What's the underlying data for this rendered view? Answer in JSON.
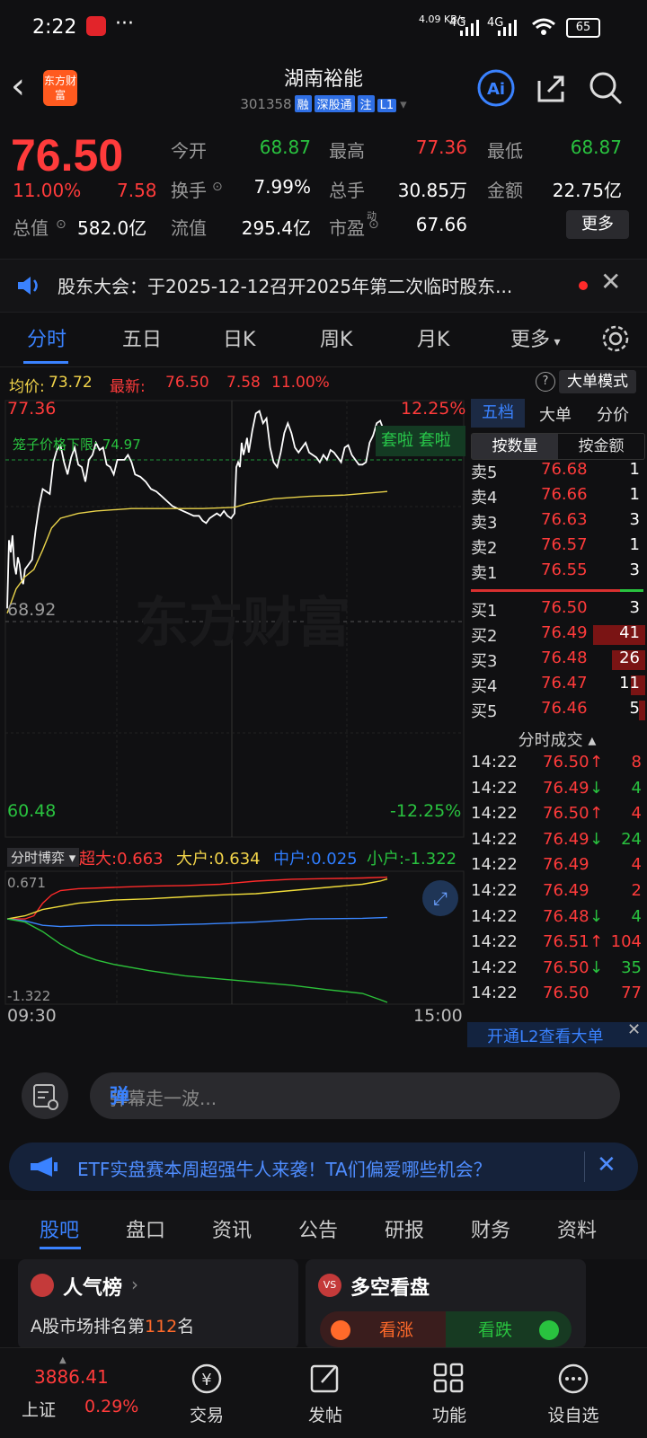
{
  "status_bar": {
    "time": "2:22",
    "net_speed": "4.09 KB/s",
    "signal1": "4G",
    "signal2": "4G",
    "battery": "65"
  },
  "header": {
    "brand": "东方财富",
    "title": "湖南裕能",
    "code": "301358",
    "tags": [
      "融",
      "深股通",
      "注",
      "L1"
    ]
  },
  "quote": {
    "price": "76.50",
    "change_pct": "11.00%",
    "change": "7.58",
    "open_label": "今开",
    "open": "68.87",
    "high_label": "最高",
    "high": "77.36",
    "low_label": "最低",
    "low": "68.87",
    "turnover_label": "换手",
    "turnover": "7.99%",
    "volume_label": "总手",
    "volume": "30.85万",
    "amount_label": "金额",
    "amount": "22.75亿",
    "mktcap_label": "总值",
    "mktcap": "582.0亿",
    "float_label": "流值",
    "float": "295.4亿",
    "pe_label": "市盈",
    "pe_sup": "动",
    "pe": "67.66",
    "more": "更多"
  },
  "announcement": {
    "text": "股东大会：于2025-12-12召开2025年第二次临时股东..."
  },
  "period_tabs": [
    "分时",
    "五日",
    "日K",
    "周K",
    "月K",
    "更多"
  ],
  "chart_header": {
    "avg_label": "均价:",
    "avg": "73.72",
    "latest_label": "最新:",
    "latest": "76.50",
    "latest_chg": "7.58",
    "latest_pct": "11.00%",
    "mode_button": "大单模式"
  },
  "chart_labels": {
    "top_price": "77.36",
    "top_pct": "12.25%",
    "limit_label": "笼子价格下限: 74.97",
    "mid_price": "68.92",
    "bottom_price": "60.48",
    "bottom_pct": "-12.25%",
    "watermark": "东方财富",
    "flag1": "套啦",
    "flag2": "套啦"
  },
  "sub_chart": {
    "selector": "分时博弈",
    "super_large_label": "超大:",
    "super_large": "0.663",
    "large_label": "大户:",
    "large": "0.634",
    "medium_label": "中户:",
    "medium": "0.025",
    "small_label": "小户:",
    "small": "-1.322",
    "max_label": "0.671",
    "min_label": "-1.322",
    "start_time": "09:30",
    "end_time": "15:00"
  },
  "order_book": {
    "tabs": [
      "五档",
      "大单",
      "分价"
    ],
    "mode_tabs": [
      "按数量",
      "按金额"
    ],
    "asks": [
      {
        "label": "卖5",
        "price": "76.68",
        "qty": "1"
      },
      {
        "label": "卖4",
        "price": "76.66",
        "qty": "1"
      },
      {
        "label": "卖3",
        "price": "76.63",
        "qty": "3"
      },
      {
        "label": "卖2",
        "price": "76.57",
        "qty": "1"
      },
      {
        "label": "卖1",
        "price": "76.55",
        "qty": "3"
      }
    ],
    "bids": [
      {
        "label": "买1",
        "price": "76.50",
        "qty": "3",
        "bar": 0.0
      },
      {
        "label": "买2",
        "price": "76.49",
        "qty": "41",
        "bar": 1.0
      },
      {
        "label": "买3",
        "price": "76.48",
        "qty": "26",
        "bar": 0.63
      },
      {
        "label": "买4",
        "price": "76.47",
        "qty": "11",
        "bar": 0.27
      },
      {
        "label": "买5",
        "price": "76.46",
        "qty": "5",
        "bar": 0.12
      }
    ],
    "trades_title": "分时成交",
    "trades": [
      {
        "time": "14:22",
        "price": "76.50",
        "dir": "↑",
        "qty": "8",
        "color": "red"
      },
      {
        "time": "14:22",
        "price": "76.49",
        "dir": "↓",
        "qty": "4",
        "color": "red"
      },
      {
        "time": "14:22",
        "price": "76.50",
        "dir": "↑",
        "qty": "4",
        "color": "red"
      },
      {
        "time": "14:22",
        "price": "76.49",
        "dir": "↓",
        "qty": "24",
        "color": "red"
      },
      {
        "time": "14:22",
        "price": "76.49",
        "dir": "",
        "qty": "4",
        "color": "red"
      },
      {
        "time": "14:22",
        "price": "76.49",
        "dir": "",
        "qty": "2",
        "color": "red"
      },
      {
        "time": "14:22",
        "price": "76.48",
        "dir": "↓",
        "qty": "4",
        "color": "red"
      },
      {
        "time": "14:22",
        "price": "76.51",
        "dir": "↑",
        "qty": "104",
        "color": "red"
      },
      {
        "time": "14:22",
        "price": "76.50",
        "dir": "↓",
        "qty": "35",
        "color": "red"
      },
      {
        "time": "14:22",
        "price": "76.50",
        "dir": "",
        "qty": "77",
        "color": "red"
      }
    ],
    "l2_promo": "开通L2查看大单"
  },
  "danmu": {
    "placeholder": "弹幕走一波...",
    "send": "弹"
  },
  "etf_banner": {
    "text": "ETF实盘赛本周超强牛人来袭！TA们偏爱哪些机会？"
  },
  "bottom_tabs": [
    "股吧",
    "盘口",
    "资讯",
    "公告",
    "研报",
    "财务",
    "资料"
  ],
  "cards": {
    "left_title": "人气榜",
    "left_sub_prefix": "A股市场排名第",
    "left_rank": "112",
    "left_sub_suffix": "名",
    "right_title": "多空看盘",
    "bull": "看涨",
    "bear": "看跌"
  },
  "nav": {
    "index_value": "3886.41",
    "index_name": "上证",
    "index_pct": "0.29%",
    "items": [
      "交易",
      "发帖",
      "功能",
      "设自选"
    ]
  },
  "chart_data": {
    "type": "line",
    "title": "",
    "ylim": [
      60.48,
      77.36
    ],
    "prev_close": 68.92,
    "series": [
      {
        "name": "",
        "color": "#ffffff",
        "points": [
          [
            0,
            69.2
          ],
          [
            2,
            72.0
          ],
          [
            4,
            71.5
          ],
          [
            6,
            72.2
          ],
          [
            8,
            71.0
          ],
          [
            10,
            70.6
          ],
          [
            12,
            71.3
          ],
          [
            14,
            71.0
          ],
          [
            16,
            70.4
          ],
          [
            18,
            70.2
          ],
          [
            20,
            70.8
          ],
          [
            24,
            71.0
          ],
          [
            28,
            71.2
          ],
          [
            32,
            72.4
          ],
          [
            36,
            73.4
          ],
          [
            40,
            74.1
          ],
          [
            44,
            74.0
          ],
          [
            48,
            73.9
          ],
          [
            52,
            75.2
          ],
          [
            56,
            75.7
          ],
          [
            60,
            75.9
          ],
          [
            64,
            75.2
          ],
          [
            68,
            74.7
          ],
          [
            72,
            75.4
          ],
          [
            76,
            75.8
          ],
          [
            80,
            75.1
          ],
          [
            84,
            75.0
          ],
          [
            88,
            74.4
          ],
          [
            92,
            75.3
          ],
          [
            96,
            75.5
          ],
          [
            100,
            76.0
          ],
          [
            104,
            75.7
          ],
          [
            108,
            75.8
          ],
          [
            112,
            75.1
          ],
          [
            116,
            75.0
          ],
          [
            120,
            74.7
          ],
          [
            124,
            75.3
          ],
          [
            128,
            75.3
          ],
          [
            132,
            75.3
          ],
          [
            136,
            75.5
          ],
          [
            140,
            75.2
          ],
          [
            144,
            74.7
          ],
          [
            150,
            74.6
          ],
          [
            156,
            74.4
          ],
          [
            162,
            74.1
          ],
          [
            168,
            74.0
          ],
          [
            174,
            73.8
          ],
          [
            180,
            73.6
          ],
          [
            186,
            73.4
          ],
          [
            192,
            73.3
          ],
          [
            198,
            73.2
          ],
          [
            204,
            73.1
          ],
          [
            210,
            73.0
          ],
          [
            216,
            73.0
          ],
          [
            220,
            72.8
          ],
          [
            224,
            72.7
          ],
          [
            228,
            72.9
          ],
          [
            232,
            73.0
          ],
          [
            236,
            73.1
          ],
          [
            240,
            73.0
          ],
          [
            244,
            73.2
          ],
          [
            248,
            73.0
          ],
          [
            252,
            72.9
          ],
          [
            256,
            73.1
          ],
          [
            258,
            75.0
          ],
          [
            260,
            75.2
          ],
          [
            262,
            75.0
          ],
          [
            264,
            76.0
          ],
          [
            266,
            75.5
          ],
          [
            268,
            75.8
          ],
          [
            270,
            76.2
          ],
          [
            272,
            75.6
          ],
          [
            276,
            76.5
          ],
          [
            280,
            77.2
          ],
          [
            284,
            77.3
          ],
          [
            288,
            76.8
          ],
          [
            292,
            77.0
          ],
          [
            296,
            75.8
          ],
          [
            300,
            75.2
          ],
          [
            304,
            75.0
          ],
          [
            308,
            75.6
          ],
          [
            312,
            76.4
          ],
          [
            316,
            76.8
          ],
          [
            320,
            76.4
          ],
          [
            324,
            75.8
          ],
          [
            328,
            75.6
          ],
          [
            332,
            75.8
          ],
          [
            336,
            76.0
          ],
          [
            340,
            75.6
          ],
          [
            344,
            75.5
          ],
          [
            348,
            75.4
          ],
          [
            352,
            75.2
          ],
          [
            356,
            75.5
          ],
          [
            360,
            75.3
          ],
          [
            364,
            75.7
          ],
          [
            368,
            75.6
          ],
          [
            372,
            75.4
          ],
          [
            376,
            75.2
          ],
          [
            380,
            75.8
          ],
          [
            384,
            75.9
          ],
          [
            388,
            75.5
          ],
          [
            392,
            75.3
          ],
          [
            396,
            75.1
          ],
          [
            400,
            75.1
          ],
          [
            404,
            75.2
          ],
          [
            408,
            76.0
          ],
          [
            412,
            76.3
          ],
          [
            416,
            76.8
          ],
          [
            420,
            76.9
          ],
          [
            424,
            76.5
          ],
          [
            428,
            76.6
          ]
        ]
      },
      {
        "name": "",
        "color": "#e8d24a",
        "points": [
          [
            0,
            69.0
          ],
          [
            10,
            70.0
          ],
          [
            20,
            70.5
          ],
          [
            30,
            70.8
          ],
          [
            40,
            71.6
          ],
          [
            50,
            72.5
          ],
          [
            60,
            72.9
          ],
          [
            80,
            73.1
          ],
          [
            100,
            73.2
          ],
          [
            140,
            73.3
          ],
          [
            180,
            73.3
          ],
          [
            220,
            73.3
          ],
          [
            256,
            73.35
          ],
          [
            270,
            73.5
          ],
          [
            300,
            73.7
          ],
          [
            340,
            73.8
          ],
          [
            380,
            73.85
          ],
          [
            428,
            74.0
          ]
        ]
      }
    ]
  },
  "sub_chart_data": {
    "type": "line",
    "ylim": [
      -1.322,
      0.671
    ],
    "series": [
      {
        "name": "超大",
        "color": "#ff2a2a",
        "points": [
          [
            0,
            0
          ],
          [
            20,
            0.0
          ],
          [
            30,
            0.05
          ],
          [
            40,
            0.25
          ],
          [
            50,
            0.38
          ],
          [
            60,
            0.45
          ],
          [
            80,
            0.48
          ],
          [
            120,
            0.5
          ],
          [
            160,
            0.52
          ],
          [
            200,
            0.53
          ],
          [
            240,
            0.55
          ],
          [
            280,
            0.6
          ],
          [
            320,
            0.63
          ],
          [
            360,
            0.64
          ],
          [
            400,
            0.65
          ],
          [
            428,
            0.663
          ]
        ]
      },
      {
        "name": "大户",
        "color": "#f0dc3a",
        "points": [
          [
            0,
            0
          ],
          [
            20,
            0.05
          ],
          [
            40,
            0.15
          ],
          [
            60,
            0.2
          ],
          [
            80,
            0.25
          ],
          [
            120,
            0.3
          ],
          [
            160,
            0.32
          ],
          [
            200,
            0.35
          ],
          [
            240,
            0.38
          ],
          [
            280,
            0.4
          ],
          [
            320,
            0.45
          ],
          [
            360,
            0.5
          ],
          [
            400,
            0.55
          ],
          [
            420,
            0.6
          ],
          [
            428,
            0.634
          ]
        ]
      },
      {
        "name": "中户",
        "color": "#3a86ff",
        "points": [
          [
            0,
            0
          ],
          [
            20,
            -0.03
          ],
          [
            40,
            -0.1
          ],
          [
            60,
            -0.12
          ],
          [
            100,
            -0.1
          ],
          [
            160,
            -0.1
          ],
          [
            220,
            -0.08
          ],
          [
            280,
            -0.05
          ],
          [
            340,
            0.0
          ],
          [
            400,
            0.01
          ],
          [
            428,
            0.025
          ]
        ]
      },
      {
        "name": "小户",
        "color": "#2cc13a",
        "points": [
          [
            0,
            0
          ],
          [
            20,
            -0.05
          ],
          [
            40,
            -0.2
          ],
          [
            60,
            -0.4
          ],
          [
            80,
            -0.55
          ],
          [
            100,
            -0.65
          ],
          [
            120,
            -0.72
          ],
          [
            160,
            -0.82
          ],
          [
            200,
            -0.9
          ],
          [
            240,
            -0.95
          ],
          [
            280,
            -1.0
          ],
          [
            320,
            -1.05
          ],
          [
            360,
            -1.12
          ],
          [
            400,
            -1.18
          ],
          [
            420,
            -1.28
          ],
          [
            428,
            -1.322
          ]
        ]
      }
    ]
  }
}
